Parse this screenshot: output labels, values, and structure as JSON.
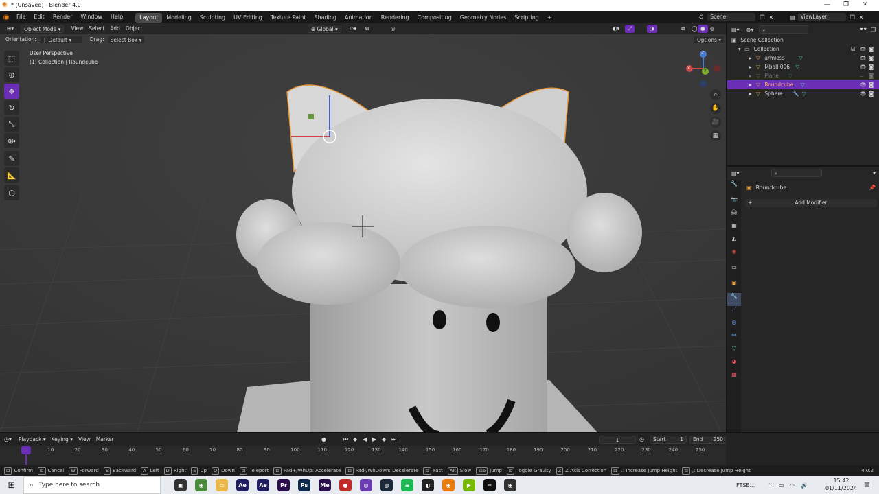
{
  "window": {
    "title": "* (Unsaved) - Blender 4.0",
    "minimize": "—",
    "maximize": "❐",
    "close": "✕"
  },
  "menu": [
    "File",
    "Edit",
    "Render",
    "Window",
    "Help"
  ],
  "workspaces": [
    {
      "label": "Layout",
      "active": true
    },
    {
      "label": "Modeling"
    },
    {
      "label": "Sculpting"
    },
    {
      "label": "UV Editing"
    },
    {
      "label": "Texture Paint"
    },
    {
      "label": "Shading"
    },
    {
      "label": "Animation"
    },
    {
      "label": "Rendering"
    },
    {
      "label": "Compositing"
    },
    {
      "label": "Geometry Nodes"
    },
    {
      "label": "Scripting"
    },
    {
      "label": "+"
    }
  ],
  "scene": {
    "label": "Scene",
    "viewlayer": "ViewLayer"
  },
  "viewport_header": {
    "mode": "Object Mode",
    "view": "View",
    "select": "Select",
    "add": "Add",
    "object": "Object",
    "transform": "Global",
    "options": "Options"
  },
  "header2": {
    "orientation_label": "Orientation:",
    "orientation_value": "Default",
    "drag_label": "Drag:",
    "drag_value": "Select Box"
  },
  "overlay": {
    "perspective": "User Perspective",
    "collection": "(1) Collection | Roundcube"
  },
  "gizmo": {
    "z": "Z",
    "y": "Y",
    "x": "X"
  },
  "outliner": {
    "rows": [
      {
        "label": "Scene Collection",
        "indent": 0,
        "selected": false
      },
      {
        "label": "Collection",
        "indent": 1,
        "selected": false
      },
      {
        "label": "armless",
        "indent": 2,
        "selected": false
      },
      {
        "label": "Mball.006",
        "indent": 2,
        "selected": false
      },
      {
        "label": "Plane",
        "indent": 2,
        "selected": false,
        "dim": true
      },
      {
        "label": "Roundcube",
        "indent": 2,
        "selected": true
      },
      {
        "label": "Sphere",
        "indent": 2,
        "selected": false
      }
    ]
  },
  "properties": {
    "object_name": "Roundcube",
    "add_modifier": "Add Modifier"
  },
  "timeline": {
    "playback": "Playback",
    "keying": "Keying",
    "view": "View",
    "marker": "Marker",
    "current_frame": "1",
    "start_label": "Start",
    "start": "1",
    "end_label": "End",
    "end": "250",
    "ticks": [
      "1",
      "10",
      "20",
      "30",
      "40",
      "50",
      "60",
      "70",
      "80",
      "90",
      "100",
      "110",
      "120",
      "130",
      "140",
      "150",
      "160",
      "170",
      "180",
      "190",
      "200",
      "210",
      "220",
      "230",
      "240",
      "250"
    ]
  },
  "status": [
    {
      "key": "",
      "text": "Confirm"
    },
    {
      "key": "",
      "text": "Cancel"
    },
    {
      "key": "W",
      "text": "Forward"
    },
    {
      "key": "S",
      "text": "Backward"
    },
    {
      "key": "A",
      "text": "Left"
    },
    {
      "key": "D",
      "text": "Right"
    },
    {
      "key": "E",
      "text": "Up"
    },
    {
      "key": "Q",
      "text": "Down"
    },
    {
      "key": "",
      "text": "Teleport"
    },
    {
      "key": "",
      "text": "Pad+/WhUp: Accelerate"
    },
    {
      "key": "",
      "text": "Pad-/WhDown: Decelerate"
    },
    {
      "key": "",
      "text": "Fast"
    },
    {
      "key": "Alt",
      "text": "Slow"
    },
    {
      "key": "Tab",
      "text": "Jump"
    },
    {
      "key": "",
      "text": "Toggle Gravity"
    },
    {
      "key": "Z",
      "text": "Z Axis Correction"
    },
    {
      "key": "",
      "text": ".: Increase Jump Height"
    },
    {
      "key": "",
      "text": ",: Decrease Jump Height"
    }
  ],
  "version": "4.0.2",
  "taskbar": {
    "search_placeholder": "Type here to search",
    "ticker": "FTSE...",
    "time": "15:42",
    "date": "01/11/2024"
  },
  "colors": {
    "accent": "#6b2fb6",
    "orange": "#e8a040",
    "selected_row": "#6b2fb6"
  }
}
